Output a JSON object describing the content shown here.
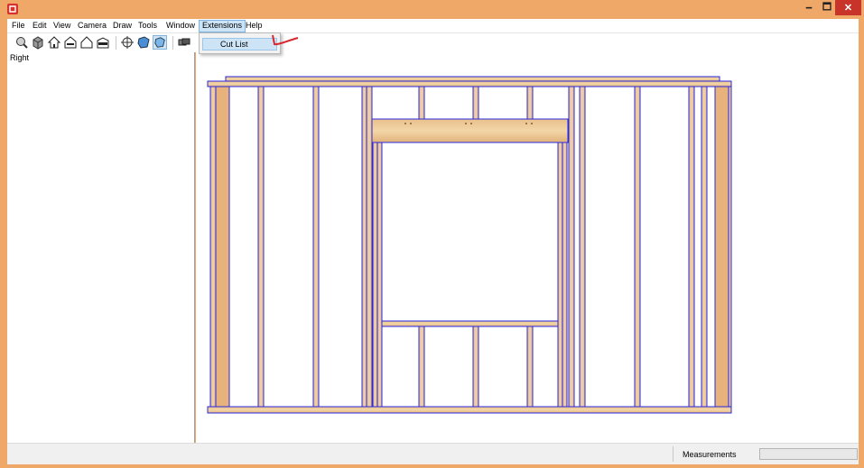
{
  "window": {
    "minimize_glyph": "🗕",
    "maximize_glyph": "🗖",
    "close_glyph": "✕"
  },
  "menubar": {
    "items": [
      "File",
      "Edit",
      "View",
      "Camera",
      "Draw",
      "Tools",
      "Window",
      "Extensions",
      "Help"
    ],
    "active": "Extensions"
  },
  "extensions_menu": {
    "items": [
      "Cut List"
    ]
  },
  "left_panel": {
    "label": "Right"
  },
  "toolbar": {
    "icons": [
      "zoom-extents-icon",
      "iso-view-icon",
      "top-view-icon",
      "front-view-icon",
      "right-view-icon",
      "back-view-icon",
      "orbit-icon",
      "pan-icon",
      "walk-icon",
      "components-icon"
    ],
    "selected": "walk-icon"
  },
  "statusbar": {
    "measurements_label": "Measurements",
    "measurements_value": ""
  },
  "colors": {
    "accent": "#f0a868",
    "wood": "#e9c699",
    "wood_dark": "#d9a86d",
    "edge": "#2a2ae0",
    "annotation": "#d9272e"
  }
}
